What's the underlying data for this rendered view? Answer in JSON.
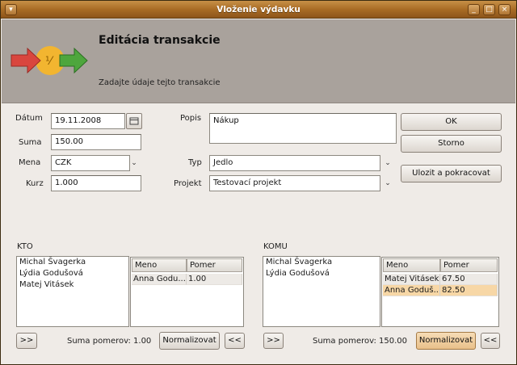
{
  "window": {
    "title": "Vloženie výdavku"
  },
  "header": {
    "title": "Editácia transakcie",
    "subtitle": "Zadajte údaje tejto transakcie"
  },
  "form": {
    "datum_label": "Dátum",
    "datum_value": "19.11.2008",
    "suma_label": "Suma",
    "suma_value": "150.00",
    "mena_label": "Mena",
    "mena_value": "CZK",
    "kurz_label": "Kurz",
    "kurz_value": "1.000",
    "popis_label": "Popis",
    "popis_value": "Nákup",
    "typ_label": "Typ",
    "typ_value": "Jedlo",
    "projekt_label": "Projekt",
    "projekt_value": "Testovací projekt"
  },
  "actions": {
    "ok": "OK",
    "storno": "Storno",
    "save_continue": "Ulozit a pokracovat"
  },
  "kto": {
    "label": "KTO",
    "people": [
      "Michal Švagerka",
      "Lýdia Godušová",
      "Matej Vitásek"
    ],
    "columns": [
      "Meno",
      "Pomer"
    ],
    "rows": [
      {
        "meno": "Anna Godu...",
        "pomer": "1.00"
      }
    ],
    "add_button": ">>",
    "remove_button": "<<",
    "sum_text": "Suma pomerov: 1.00",
    "normalize": "Normalizovat"
  },
  "komu": {
    "label": "KOMU",
    "people": [
      "Michal Švagerka",
      "Lýdia Godušová"
    ],
    "columns": [
      "Meno",
      "Pomer"
    ],
    "rows": [
      {
        "meno": "Matej Vitásek",
        "pomer": "67.50"
      },
      {
        "meno": "Anna Goduš...",
        "pomer": "82.50",
        "selected": true
      }
    ],
    "add_button": ">>",
    "remove_button": "<<",
    "sum_text": "Suma pomerov: 150.00",
    "normalize": "Normalizovat"
  },
  "colors": {
    "title_bar": "#a96c25",
    "header_band": "#a9a29c",
    "selection": "#f7d7a6"
  }
}
